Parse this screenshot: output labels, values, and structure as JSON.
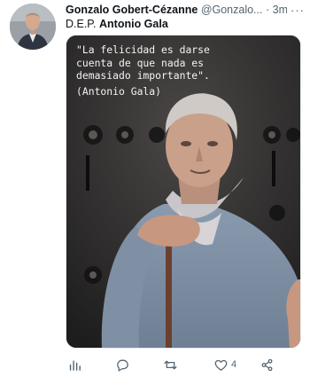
{
  "tweet": {
    "author_name": "Gonzalo Gobert-Cézanne",
    "author_handle": "@Gonzalo...",
    "separator": "·",
    "time": "3min",
    "more_icon": "more-horizontal-icon",
    "text_prefix": "D.E.P.",
    "text_bold": "Antonio Gala"
  },
  "media": {
    "quote_lines": [
      "\"La felicidad es darse",
      "cuenta de que nada es",
      "demasiado importante\"."
    ],
    "quote_author": "(Antonio Gala)"
  },
  "actions": {
    "views_icon": "analytics-icon",
    "reply_icon": "reply-icon",
    "retweet_icon": "retweet-icon",
    "like_icon": "heart-icon",
    "like_count": "4",
    "share_icon": "share-icon"
  },
  "colors": {
    "text": "#0f1419",
    "secondary": "#536471",
    "background": "#ffffff"
  }
}
